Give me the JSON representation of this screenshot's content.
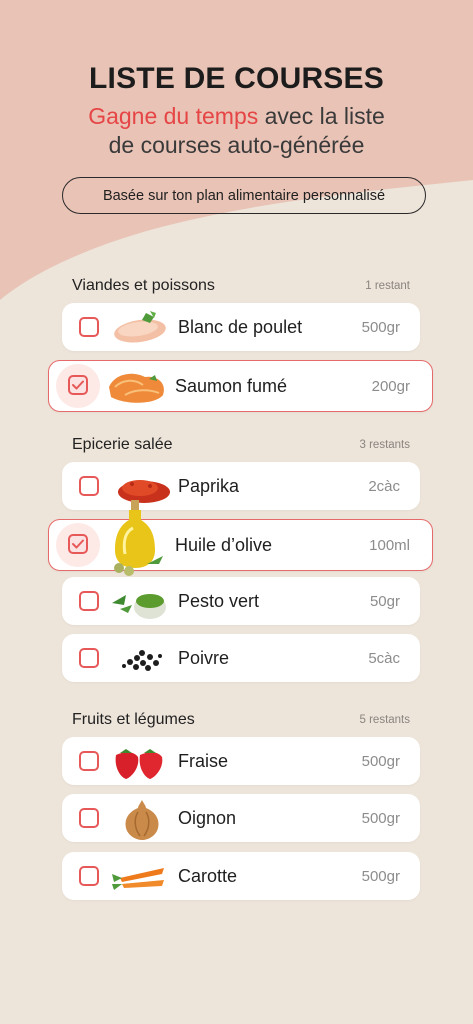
{
  "header": {
    "title": "LISTE DE COURSES",
    "subtitle_highlight": "Gagne du temps",
    "subtitle_rest_line1": " avec la liste",
    "subtitle_line2": "de courses auto-générée",
    "pill": "Basée sur ton plan alimentaire personnalisé"
  },
  "colors": {
    "accent": "#e64545",
    "background": "#ede4da",
    "pink_shape": "#e9c3b6"
  },
  "sections": [
    {
      "name": "Viandes et poissons",
      "count": "1 restant",
      "items": [
        {
          "label": "Blanc de poulet",
          "qty": "500gr",
          "checked": false,
          "icon": "chicken-breast-icon"
        },
        {
          "label": "Saumon fumé",
          "qty": "200gr",
          "checked": true,
          "icon": "smoked-salmon-icon"
        }
      ]
    },
    {
      "name": "Epicerie salée",
      "count": "3 restants",
      "items": [
        {
          "label": "Paprika",
          "qty": "2càc",
          "checked": false,
          "icon": "paprika-icon"
        },
        {
          "label": "Huile d’olive",
          "qty": "100ml",
          "checked": true,
          "icon": "olive-oil-icon"
        },
        {
          "label": "Pesto vert",
          "qty": "50gr",
          "checked": false,
          "icon": "pesto-icon"
        },
        {
          "label": "Poivre",
          "qty": "5càc",
          "checked": false,
          "icon": "pepper-icon"
        }
      ]
    },
    {
      "name": "Fruits et légumes",
      "count": "5 restants",
      "items": [
        {
          "label": "Fraise",
          "qty": "500gr",
          "checked": false,
          "icon": "strawberry-icon"
        },
        {
          "label": "Oignon",
          "qty": "500gr",
          "checked": false,
          "icon": "onion-icon"
        },
        {
          "label": "Carotte",
          "qty": "500gr",
          "checked": false,
          "icon": "carrot-icon"
        }
      ]
    }
  ]
}
